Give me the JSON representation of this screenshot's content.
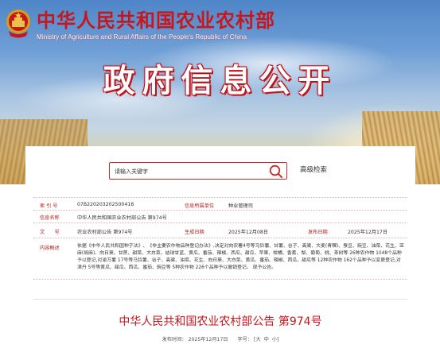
{
  "header": {
    "ministry_cn": "中华人民共和国农业农村部",
    "ministry_en": "Ministry of Agriculture and Rural Affairs of the People's Republic of China",
    "page_heading": "政府信息公开"
  },
  "search": {
    "placeholder": "请输入关键字",
    "advanced_label": "高级检索",
    "icon": "search-icon"
  },
  "info": {
    "index_label": "索 引 号",
    "index_value": "07B220203202500418",
    "org_label": "信息所属单位",
    "org_value": "种业管理司",
    "name_label": "信息名称",
    "name_value": "中华人民共和国农业农村部公告 第974号",
    "doc_no_label": "文　　号",
    "doc_no_value": "农业农村部公告 第974号",
    "gen_date_label": "生成日期",
    "gen_date_value": "2025年12月08日",
    "pub_date_label": "发布日期",
    "pub_date_value": "2025年12月17日",
    "summary_label": "内容概述",
    "summary_value": "依据《中华人民共和国种子法》、《非主要农作物品种登记办法》,决定对向农署4号等马铃薯、甘薯、谷子、高粱、大麦(青稞)、蚕豆、豌豆、油菜、花生、亚麻(胡麻)、向日葵、甘蔗、甜菜、大白菜、结球甘蓝、黄瓜、番茄、辣椒、西瓜、甜瓜、苹果、柑橘、香蕉、梨、葡萄、桃、茶树等 26种农作物 1048个品种予以登记,对渝万薯 17号等马铃薯、谷子、高粱、油菜、花生、向日葵、大白菜、黄瓜、番茄、辣椒、西瓜、甜瓜等 12种农作物 162个品种予以变更登记,对津丹 5号等黄瓜、甜瓜、西瓜、番茄、豌豆等 5种农作物 226个品种予以撤销登记。 现予公告。"
  },
  "document": {
    "title": "中华人民共和国农业农村部公告 第974号",
    "date_label": "发布时间：",
    "date_value": "2025年12月17日",
    "font_size_label": "字号：",
    "font_sizes": [
      "[大",
      "中",
      "小]"
    ]
  },
  "colors": {
    "brand_red": "#c8161d",
    "label_red": "#b22222"
  }
}
